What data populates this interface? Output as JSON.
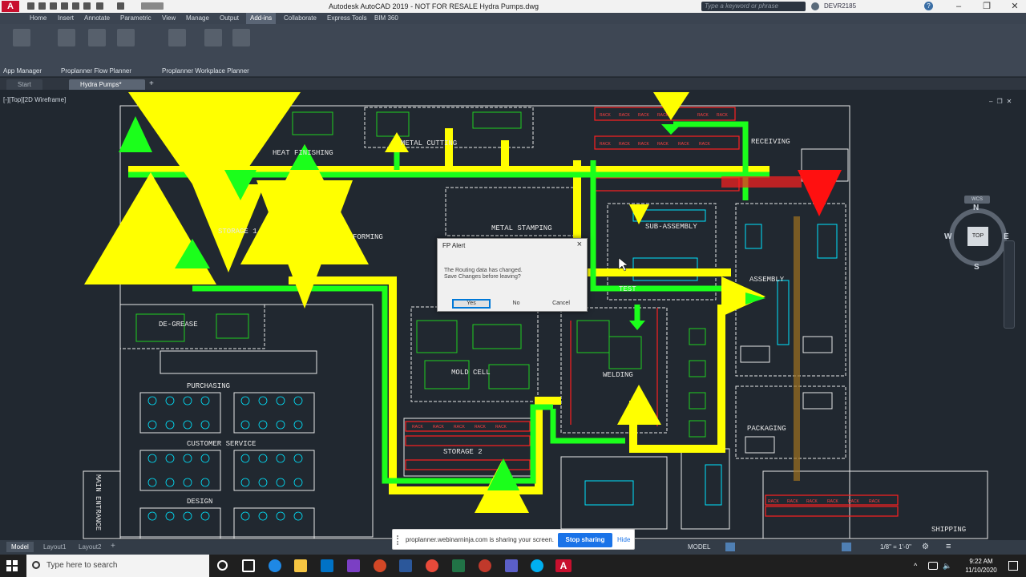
{
  "title_bar": {
    "app_logo": "A",
    "title": "Autodesk AutoCAD 2019 - NOT FOR RESALE   Hydra Pumps.dwg",
    "search_placeholder": "Type a keyword or phrase",
    "user": "DEVR2185"
  },
  "ribbon": {
    "tabs": [
      "Home",
      "Insert",
      "Annotate",
      "Parametric",
      "View",
      "Manage",
      "Output",
      "Add-ins",
      "Collaborate",
      "Express Tools",
      "BIM 360"
    ],
    "active_tab": "Add-ins",
    "panel_labels": [
      "App Manager",
      "Proplanner Flow Planner",
      "Proplanner Workplace Planner"
    ]
  },
  "file_tabs": [
    "Start",
    "Hydra Pumps*"
  ],
  "viewport": {
    "label": "[-][Top][2D Wireframe]"
  },
  "viewcube": {
    "north": "N",
    "south": "S",
    "east": "E",
    "west": "W",
    "face": "TOP",
    "wcs": "WCS"
  },
  "drawing_labels": {
    "heat_finishing": "HEAT FINISHING",
    "metal_cutting": "METAL CUTTING",
    "receiving": "RECEIVING",
    "storage1": "STORAGE 1",
    "forming": "FORMING",
    "metal_stamping": "METAL STAMPING",
    "sub_assembly": "SUB-ASSEMBLY",
    "test": "TEST",
    "assembly": "ASSEMBLY",
    "degrease": "DE-GREASE",
    "mold_cell": "MOLD CELL",
    "welding": "WELDING",
    "purchasing": "PURCHASING",
    "customer_service": "CUSTOMER SERVICE",
    "design": "DESIGN",
    "storage2": "STORAGE 2",
    "packaging": "PACKAGING",
    "shipping": "SHIPPING",
    "main_entrance": "MAIN ENTRANCE",
    "rack": "RACK"
  },
  "dialog": {
    "title": "FP Alert",
    "close": "×",
    "message_line1": "The Routing data has changed.",
    "message_line2": "Save Changes before leaving?",
    "yes": "Yes",
    "no": "No",
    "cancel": "Cancel"
  },
  "status_bar": {
    "tabs": [
      "Model",
      "Layout1",
      "Layout2"
    ],
    "model_label": "MODEL",
    "scale": "1/8\" = 1'-0\""
  },
  "screen_share": {
    "message": "proplanner.webinarninja.com is sharing your screen.",
    "stop": "Stop sharing",
    "hide": "Hide"
  },
  "taskbar": {
    "search_placeholder": "Type here to search",
    "time": "9:22 AM",
    "date": "11/10/2020"
  },
  "colors": {
    "route_yellow": "#ffff00",
    "route_green": "#1bff1b",
    "rack_red": "#ff2020",
    "drawing_white": "#e8e8e8",
    "cyan": "#00e5ff"
  }
}
